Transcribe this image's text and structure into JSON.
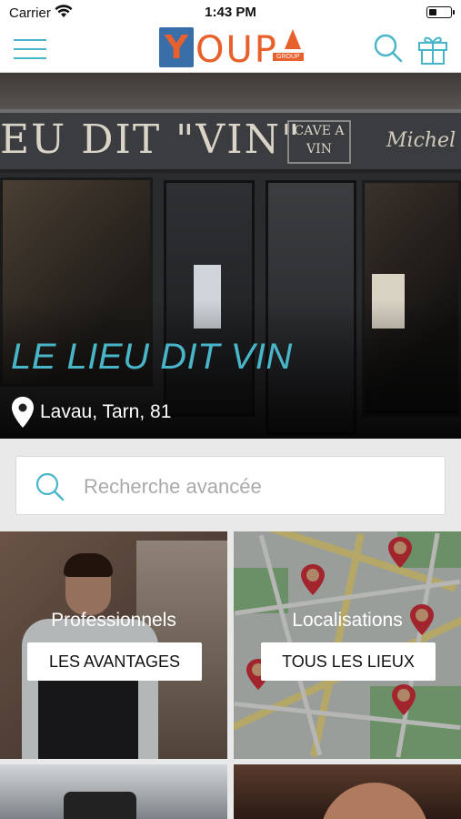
{
  "status_bar": {
    "carrier": "Carrier",
    "time": "1:43 PM"
  },
  "header": {
    "logo_letters": {
      "y": "Y",
      "rest": "OUP",
      "group": "GROUP"
    }
  },
  "hero": {
    "storefront_text": "EU DIT \"VIN\"",
    "cave_text": "CAVE A VIN",
    "michel_text": "Michel",
    "title": "LE LIEU DIT VIN",
    "location": "Lavau, Tarn, 81"
  },
  "search": {
    "placeholder": "Recherche avancée"
  },
  "tiles": [
    {
      "label": "Professionnels",
      "button": "LES AVANTAGES"
    },
    {
      "label": "Localisations",
      "button": "TOUS LES LIEUX"
    }
  ],
  "colors": {
    "accent": "#49b5c9",
    "brand_orange": "#e8602c",
    "brand_blue": "#3a6ea8",
    "marker": "#d8323c"
  }
}
